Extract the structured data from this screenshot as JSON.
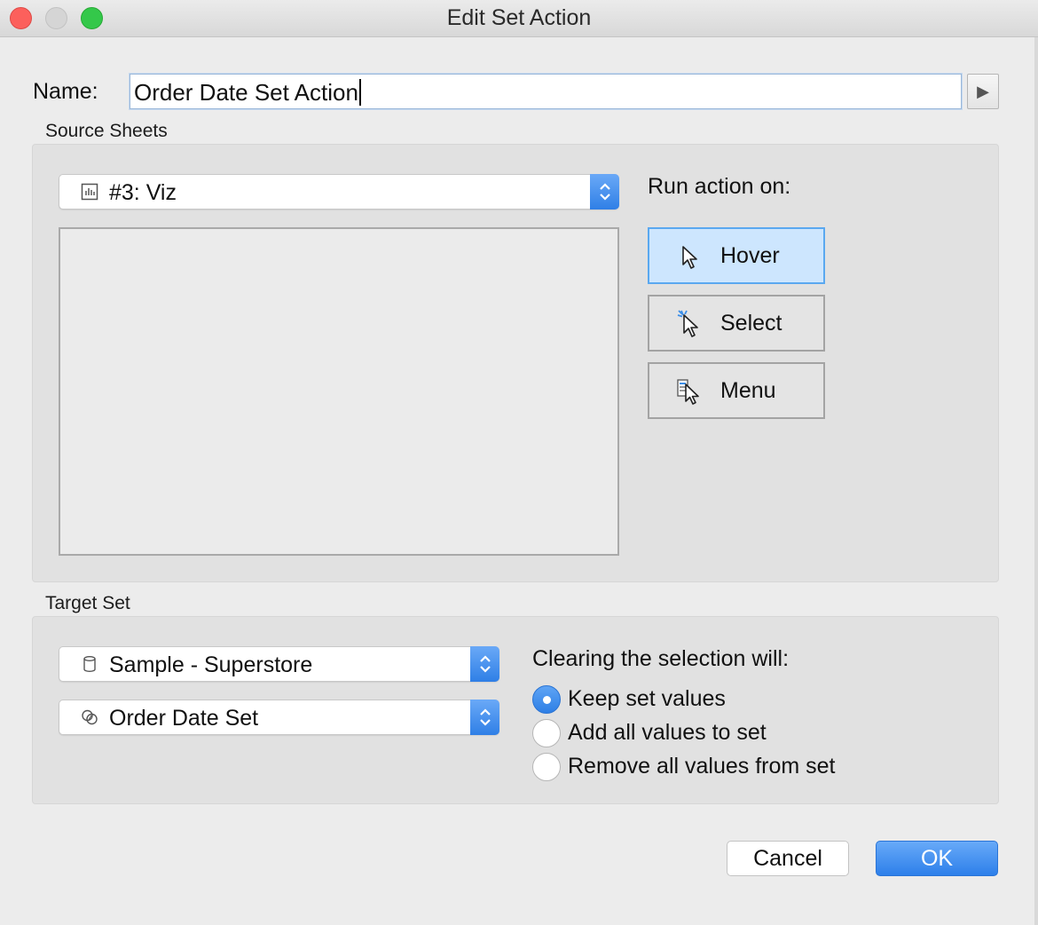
{
  "window": {
    "title": "Edit Set Action"
  },
  "name": {
    "label": "Name:",
    "value": "Order Date Set Action"
  },
  "source_sheets": {
    "label": "Source Sheets",
    "sheet_select": {
      "selected": "#3: Viz",
      "icon": "sheet-icon"
    },
    "run_action": {
      "label": "Run action on:",
      "options": [
        {
          "label": "Hover",
          "icon": "hover-cursor-icon",
          "active": true
        },
        {
          "label": "Select",
          "icon": "select-cursor-icon",
          "active": false
        },
        {
          "label": "Menu",
          "icon": "menu-cursor-icon",
          "active": false
        }
      ]
    }
  },
  "target_set": {
    "label": "Target Set",
    "datasource_select": {
      "selected": "Sample - Superstore",
      "icon": "database-icon"
    },
    "set_select": {
      "selected": "Order Date Set",
      "icon": "set-icon"
    },
    "clearing": {
      "label": "Clearing the selection will:",
      "options": [
        {
          "label": "Keep set values",
          "checked": true
        },
        {
          "label": "Add all values to set",
          "checked": false
        },
        {
          "label": "Remove all values from set",
          "checked": false
        }
      ]
    }
  },
  "buttons": {
    "cancel": "Cancel",
    "ok": "OK"
  },
  "colors": {
    "accent": "#2f7fe6",
    "active_mode_bg": "#cde6fe",
    "close": "#fc605c",
    "maximize": "#34c84a"
  }
}
